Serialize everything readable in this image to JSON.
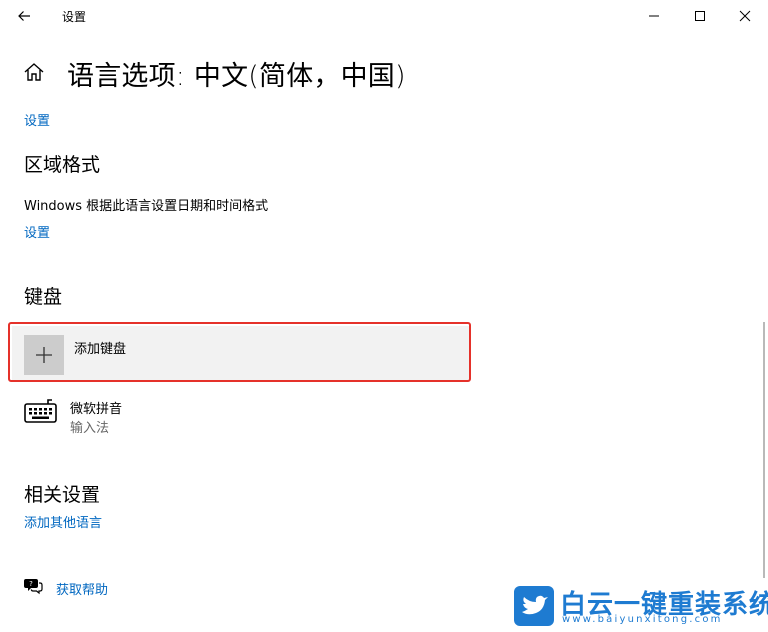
{
  "window": {
    "title": "设置",
    "controls": [
      "minimize",
      "maximize",
      "close"
    ]
  },
  "header": {
    "title": "语言选项: 中文(简体，中国)"
  },
  "top_link": "设置",
  "region": {
    "title": "区域格式",
    "description": "Windows 根据此语言设置日期和时间格式",
    "link": "设置"
  },
  "keyboard": {
    "title": "键盘",
    "add_label": "添加键盘",
    "items": [
      {
        "name": "微软拼音",
        "type": "输入法",
        "icon": "keyboard-icon"
      }
    ]
  },
  "related": {
    "title": "相关设置",
    "link": "添加其他语言"
  },
  "help": {
    "label": "获取帮助",
    "icon": "help-chat-icon"
  },
  "watermark": {
    "text": "白云一键重装系统",
    "url": "www.baiyunxitong.com"
  },
  "colors": {
    "link": "#0067c0",
    "highlight_border": "#e5312a",
    "row_background": "#f2f2f2"
  }
}
